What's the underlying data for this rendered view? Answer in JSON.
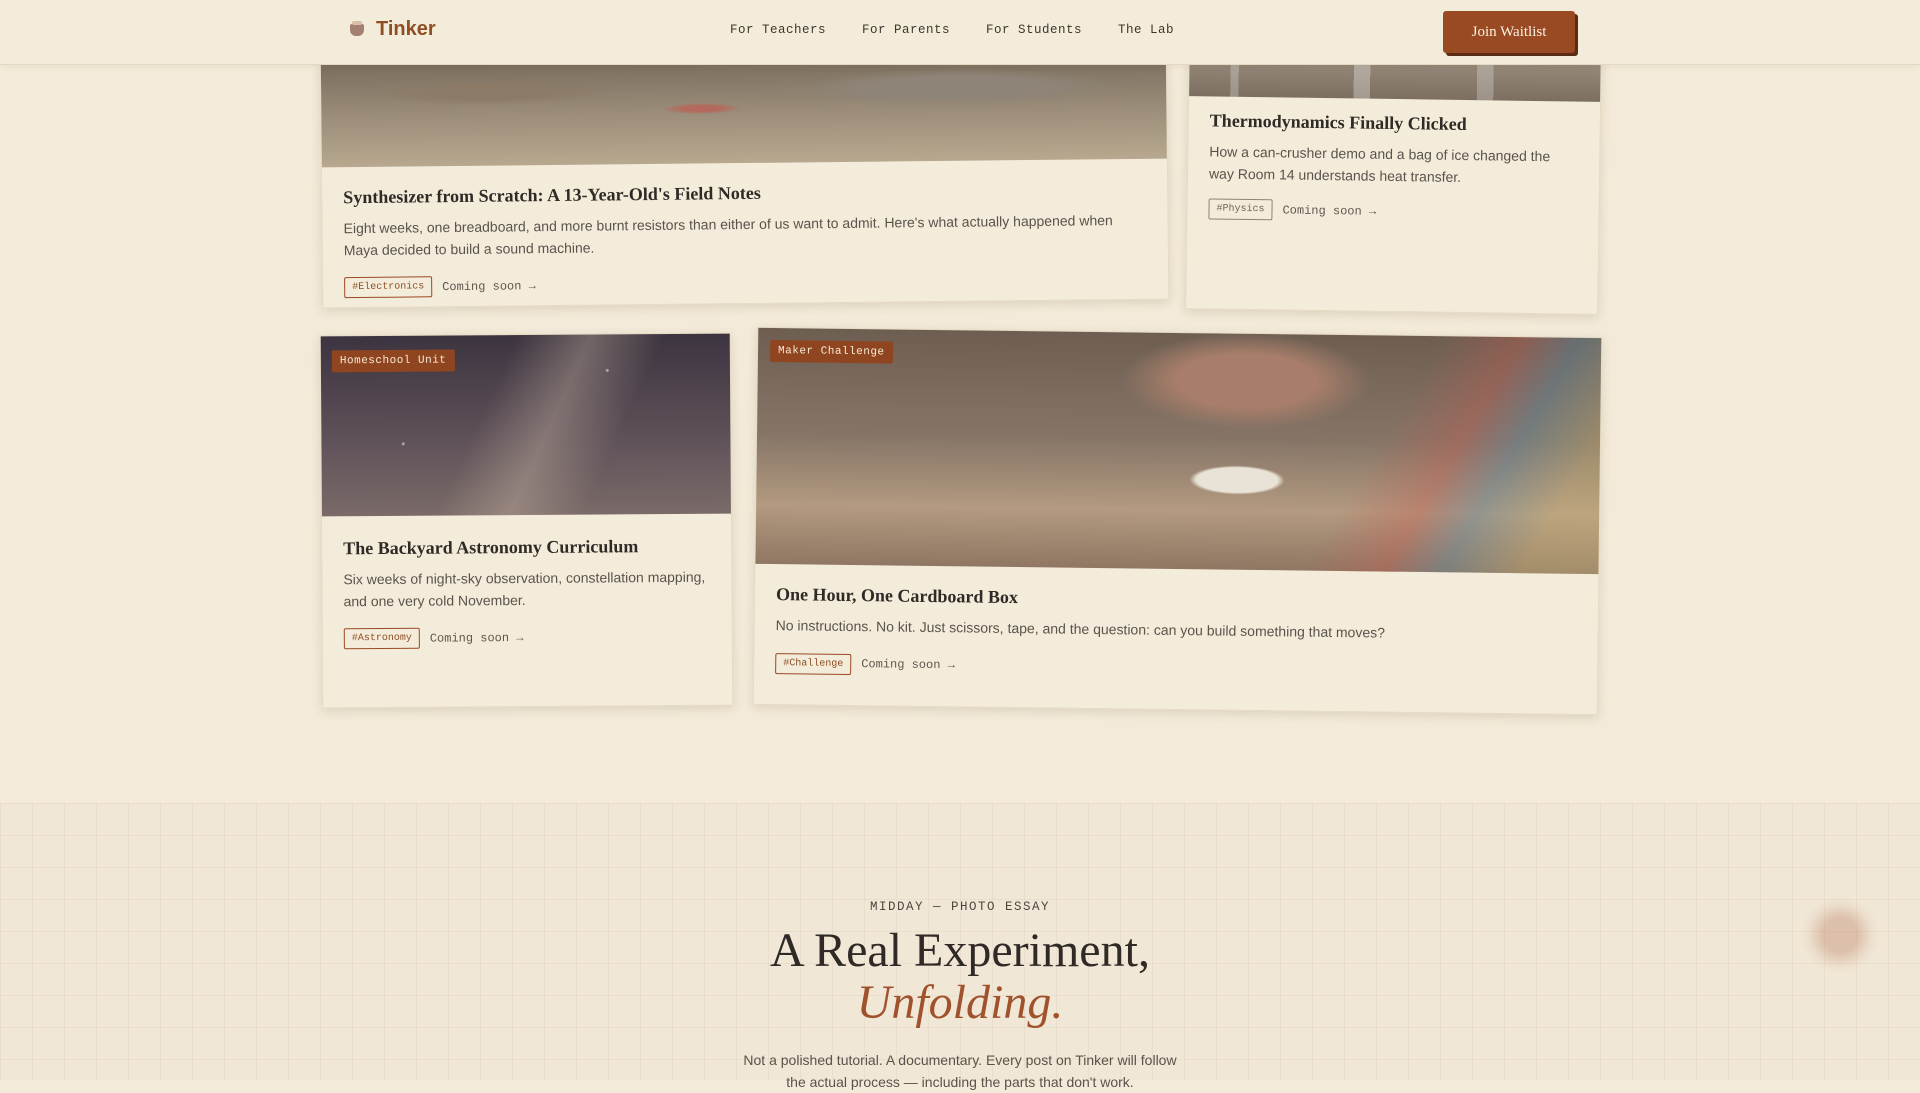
{
  "header": {
    "brand": "Tinker",
    "nav": [
      "For Teachers",
      "For Parents",
      "For Students",
      "The Lab"
    ],
    "cta": "Join Waitlist"
  },
  "cards": [
    {
      "title": "Synthesizer from Scratch: A 13-Year-Old's Field Notes",
      "desc": "Eight weeks, one breadboard, and more burnt resistors than either of us want to admit. Here's what actually happened when Maya decided to build a sound machine.",
      "tag": "#Electronics",
      "link": "Coming soon →"
    },
    {
      "title": "Thermodynamics Finally Clicked",
      "desc": "How a can-crusher demo and a bag of ice changed the way Room 14 understands heat transfer.",
      "tag": "#Physics",
      "link": "Coming soon →"
    },
    {
      "badge": "Homeschool Unit",
      "title": "The Backyard Astronomy Curriculum",
      "desc": "Six weeks of night-sky observation, constellation mapping, and one very cold November.",
      "tag": "#Astronomy",
      "link": "Coming soon →"
    },
    {
      "badge": "Maker Challenge",
      "title": "One Hour, One Cardboard Box",
      "desc": "No instructions. No kit. Just scissors, tape, and the question: can you build something that moves?",
      "tag": "#Challenge",
      "link": "Coming soon →"
    }
  ],
  "essay": {
    "eyebrow": "MIDDAY — PHOTO ESSAY",
    "title": "A Real Experiment,",
    "title_accent": "Unfolding.",
    "intro_line1": "Not a polished tutorial. A documentary. Every post on Tinker will follow",
    "intro_line2": "the actual process — including the parts that don't work."
  }
}
